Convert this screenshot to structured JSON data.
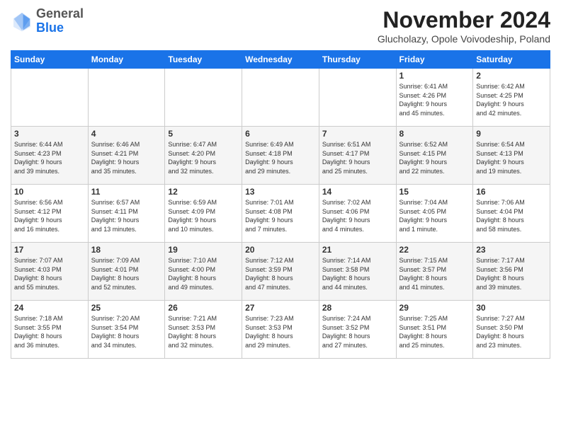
{
  "header": {
    "logo_general": "General",
    "logo_blue": "Blue",
    "month_title": "November 2024",
    "location": "Glucholazy, Opole Voivodeship, Poland"
  },
  "weekdays": [
    "Sunday",
    "Monday",
    "Tuesday",
    "Wednesday",
    "Thursday",
    "Friday",
    "Saturday"
  ],
  "weeks": [
    [
      {
        "day": "",
        "info": ""
      },
      {
        "day": "",
        "info": ""
      },
      {
        "day": "",
        "info": ""
      },
      {
        "day": "",
        "info": ""
      },
      {
        "day": "",
        "info": ""
      },
      {
        "day": "1",
        "info": "Sunrise: 6:41 AM\nSunset: 4:26 PM\nDaylight: 9 hours\nand 45 minutes."
      },
      {
        "day": "2",
        "info": "Sunrise: 6:42 AM\nSunset: 4:25 PM\nDaylight: 9 hours\nand 42 minutes."
      }
    ],
    [
      {
        "day": "3",
        "info": "Sunrise: 6:44 AM\nSunset: 4:23 PM\nDaylight: 9 hours\nand 39 minutes."
      },
      {
        "day": "4",
        "info": "Sunrise: 6:46 AM\nSunset: 4:21 PM\nDaylight: 9 hours\nand 35 minutes."
      },
      {
        "day": "5",
        "info": "Sunrise: 6:47 AM\nSunset: 4:20 PM\nDaylight: 9 hours\nand 32 minutes."
      },
      {
        "day": "6",
        "info": "Sunrise: 6:49 AM\nSunset: 4:18 PM\nDaylight: 9 hours\nand 29 minutes."
      },
      {
        "day": "7",
        "info": "Sunrise: 6:51 AM\nSunset: 4:17 PM\nDaylight: 9 hours\nand 25 minutes."
      },
      {
        "day": "8",
        "info": "Sunrise: 6:52 AM\nSunset: 4:15 PM\nDaylight: 9 hours\nand 22 minutes."
      },
      {
        "day": "9",
        "info": "Sunrise: 6:54 AM\nSunset: 4:13 PM\nDaylight: 9 hours\nand 19 minutes."
      }
    ],
    [
      {
        "day": "10",
        "info": "Sunrise: 6:56 AM\nSunset: 4:12 PM\nDaylight: 9 hours\nand 16 minutes."
      },
      {
        "day": "11",
        "info": "Sunrise: 6:57 AM\nSunset: 4:11 PM\nDaylight: 9 hours\nand 13 minutes."
      },
      {
        "day": "12",
        "info": "Sunrise: 6:59 AM\nSunset: 4:09 PM\nDaylight: 9 hours\nand 10 minutes."
      },
      {
        "day": "13",
        "info": "Sunrise: 7:01 AM\nSunset: 4:08 PM\nDaylight: 9 hours\nand 7 minutes."
      },
      {
        "day": "14",
        "info": "Sunrise: 7:02 AM\nSunset: 4:06 PM\nDaylight: 9 hours\nand 4 minutes."
      },
      {
        "day": "15",
        "info": "Sunrise: 7:04 AM\nSunset: 4:05 PM\nDaylight: 9 hours\nand 1 minute."
      },
      {
        "day": "16",
        "info": "Sunrise: 7:06 AM\nSunset: 4:04 PM\nDaylight: 8 hours\nand 58 minutes."
      }
    ],
    [
      {
        "day": "17",
        "info": "Sunrise: 7:07 AM\nSunset: 4:03 PM\nDaylight: 8 hours\nand 55 minutes."
      },
      {
        "day": "18",
        "info": "Sunrise: 7:09 AM\nSunset: 4:01 PM\nDaylight: 8 hours\nand 52 minutes."
      },
      {
        "day": "19",
        "info": "Sunrise: 7:10 AM\nSunset: 4:00 PM\nDaylight: 8 hours\nand 49 minutes."
      },
      {
        "day": "20",
        "info": "Sunrise: 7:12 AM\nSunset: 3:59 PM\nDaylight: 8 hours\nand 47 minutes."
      },
      {
        "day": "21",
        "info": "Sunrise: 7:14 AM\nSunset: 3:58 PM\nDaylight: 8 hours\nand 44 minutes."
      },
      {
        "day": "22",
        "info": "Sunrise: 7:15 AM\nSunset: 3:57 PM\nDaylight: 8 hours\nand 41 minutes."
      },
      {
        "day": "23",
        "info": "Sunrise: 7:17 AM\nSunset: 3:56 PM\nDaylight: 8 hours\nand 39 minutes."
      }
    ],
    [
      {
        "day": "24",
        "info": "Sunrise: 7:18 AM\nSunset: 3:55 PM\nDaylight: 8 hours\nand 36 minutes."
      },
      {
        "day": "25",
        "info": "Sunrise: 7:20 AM\nSunset: 3:54 PM\nDaylight: 8 hours\nand 34 minutes."
      },
      {
        "day": "26",
        "info": "Sunrise: 7:21 AM\nSunset: 3:53 PM\nDaylight: 8 hours\nand 32 minutes."
      },
      {
        "day": "27",
        "info": "Sunrise: 7:23 AM\nSunset: 3:53 PM\nDaylight: 8 hours\nand 29 minutes."
      },
      {
        "day": "28",
        "info": "Sunrise: 7:24 AM\nSunset: 3:52 PM\nDaylight: 8 hours\nand 27 minutes."
      },
      {
        "day": "29",
        "info": "Sunrise: 7:25 AM\nSunset: 3:51 PM\nDaylight: 8 hours\nand 25 minutes."
      },
      {
        "day": "30",
        "info": "Sunrise: 7:27 AM\nSunset: 3:50 PM\nDaylight: 8 hours\nand 23 minutes."
      }
    ]
  ]
}
